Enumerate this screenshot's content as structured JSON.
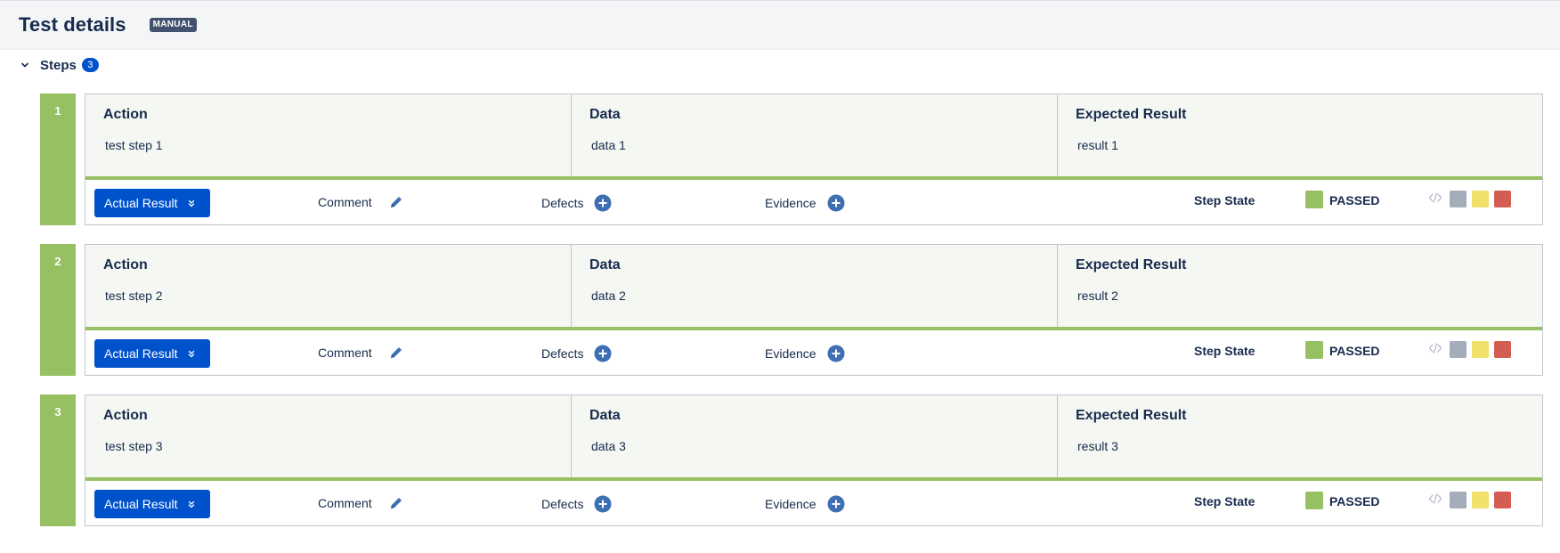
{
  "header": {
    "title": "Test details",
    "badge": "MANUAL"
  },
  "steps_section": {
    "label": "Steps",
    "count": "3"
  },
  "field_labels": {
    "action": "Action",
    "data": "Data",
    "expected": "Expected Result"
  },
  "bottom_labels": {
    "actual_result": "Actual Result",
    "comment": "Comment",
    "defects": "Defects",
    "evidence": "Evidence",
    "step_state": "Step State"
  },
  "colors": {
    "passed": "#97c063",
    "todo": "#a5adba",
    "executing": "#f1e069",
    "failed": "#d45d52",
    "primary": "#0052cc"
  },
  "steps": [
    {
      "number": "1",
      "action": "test step 1",
      "data": "data 1",
      "expected": "result 1",
      "state": "PASSED"
    },
    {
      "number": "2",
      "action": "test step 2",
      "data": "data 2",
      "expected": "result 2",
      "state": "PASSED"
    },
    {
      "number": "3",
      "action": "test step 3",
      "data": "data 3",
      "expected": "result 3",
      "state": "PASSED"
    }
  ]
}
